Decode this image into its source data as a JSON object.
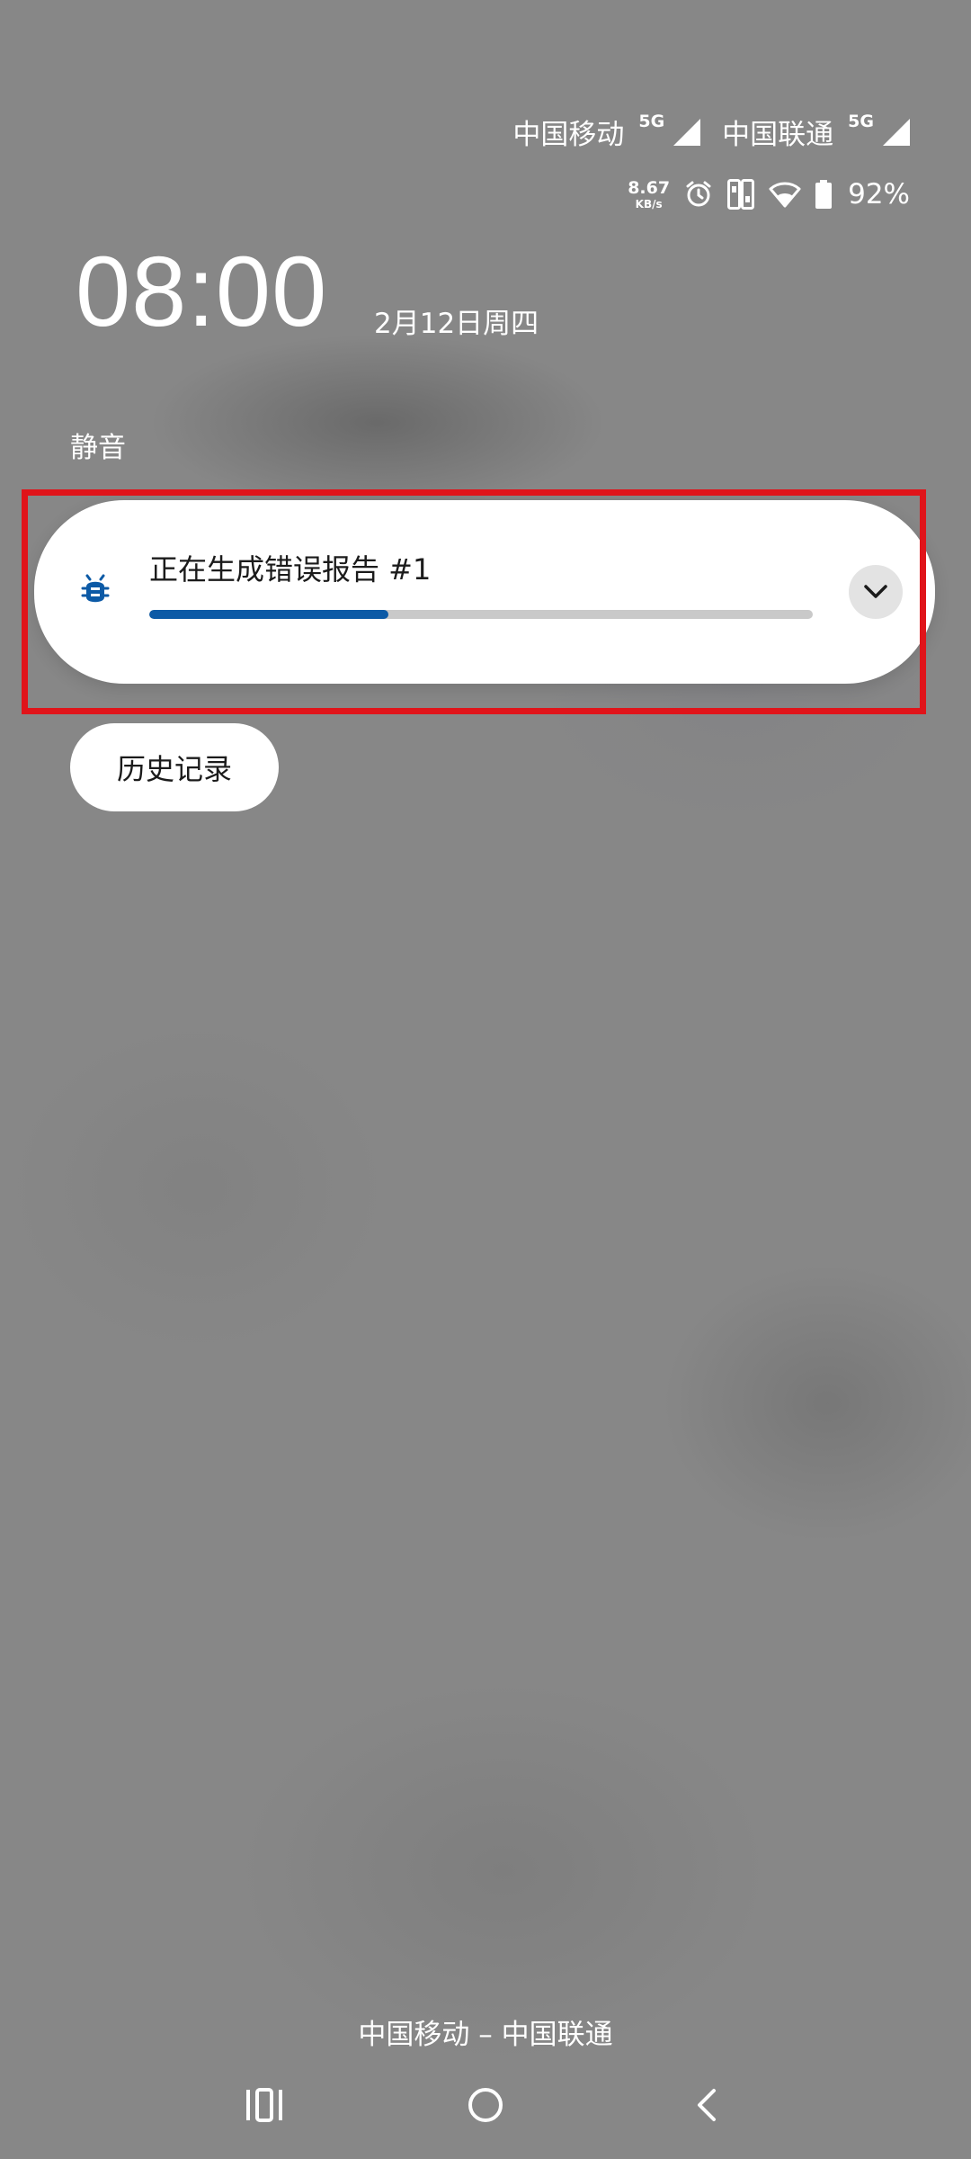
{
  "status_bar": {
    "carrier1": "中国移动",
    "carrier1_net": "5G",
    "carrier2": "中国联通",
    "carrier2_net": "5G",
    "speed_value": "8.67",
    "speed_unit": "KB/s",
    "battery_percent": "92%",
    "icons": [
      "signal-icon",
      "alarm-icon",
      "dual-sim-icon",
      "wifi-icon",
      "battery-icon"
    ]
  },
  "lockscreen": {
    "time": "08:00",
    "date": "2月12日周四"
  },
  "notifications": {
    "section_label": "静音",
    "items": [
      {
        "app_icon": "bug-report-icon",
        "title": "正在生成错误报告 #1",
        "progress": 0.36,
        "progress_color": "#0c5aa6"
      }
    ],
    "history_button": "历史记录"
  },
  "footer": {
    "carrier_text": "中国移动 – 中国联通"
  },
  "nav_bar": {
    "icons": [
      "recents-icon",
      "home-icon",
      "back-icon"
    ]
  },
  "colors": {
    "highlight": "#e0141a",
    "background": "#878787"
  }
}
